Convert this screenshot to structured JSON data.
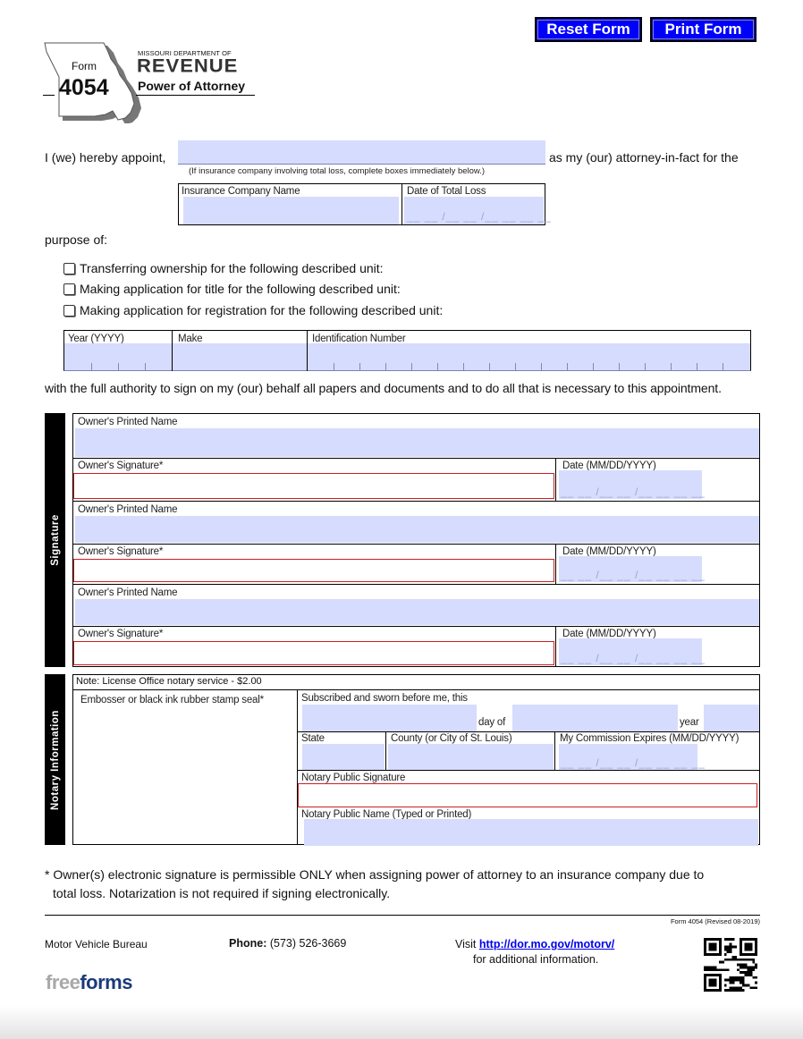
{
  "toolbar": {
    "reset_label": "Reset Form",
    "print_label": "Print Form"
  },
  "header": {
    "form_word": "Form",
    "form_number": "4054",
    "dept": "MISSOURI DEPARTMENT OF",
    "agency": "REVENUE",
    "title": "Power of Attorney"
  },
  "appoint": {
    "lead": "I (we) hereby appoint,",
    "trail": "as my (our) attorney-in-fact for the",
    "hint": "(If insurance company involving total loss, complete boxes immediately below.)",
    "insurance_label": "Insurance Company Name",
    "loss_date_label": "Date of Total Loss",
    "date_mask": "__ __ /__ __ /__ __ __ __"
  },
  "purpose": {
    "label": "purpose of:",
    "options": [
      {
        "label": "Transferring ownership for the following described unit:",
        "checked": false
      },
      {
        "label": "Making application for title for the following described unit:",
        "checked": false
      },
      {
        "label": "Making application for registration for the following described unit:",
        "checked": false
      }
    ]
  },
  "unit": {
    "year_label": "Year (YYYY)",
    "make_label": "Make",
    "id_label": "Identification Number"
  },
  "authority_text": "with the full authority to sign on my (our) behalf all papers and documents and to do all that is necessary to this appointment.",
  "signature": {
    "section_label": "Signature",
    "printed_name_label": "Owner's Printed Name",
    "signature_label": "Owner's Signature*",
    "date_label": "Date (MM/DD/YYYY)",
    "date_mask": "__ __ /__ __ /__ __ __ __"
  },
  "notary": {
    "section_label": "Notary Information",
    "note": "Note: License Office notary service - $2.00",
    "seal_label": "Embosser or black ink rubber stamp seal*",
    "sworn_label": "Subscribed and sworn before me, this",
    "day_of": "day of",
    "year": "year",
    "state_label": "State",
    "county_label": "County (or City of St. Louis)",
    "commission_label": "My Commission Expires (MM/DD/YYYY)",
    "date_mask": "__ __ /__ __ /__ __ __ __",
    "sig_label": "Notary Public Signature",
    "name_label": "Notary Public Name (Typed or Printed)"
  },
  "footnote": {
    "line1": "* Owner(s) electronic signature is permissible ONLY when assigning power of attorney to an insurance company due to",
    "line2": "total loss. Notarization is not required if signing electronically."
  },
  "footer": {
    "revision": "Form 4054 (Revised 08-2019)",
    "bureau": "Motor Vehicle Bureau",
    "phone_label": "Phone:",
    "phone": "(573) 526-3669",
    "visit": "Visit",
    "url": "http://dor.mo.gov/motorv/",
    "more_info": "for additional information.",
    "brand_free": "free",
    "brand_forms": "forms"
  },
  "colors": {
    "field_fill": "#d6dcfd",
    "signature_border": "#cc1f1f",
    "button_blue": "#0000ff",
    "link_blue": "#0000ee",
    "brand_navy": "#1a3a7a"
  }
}
